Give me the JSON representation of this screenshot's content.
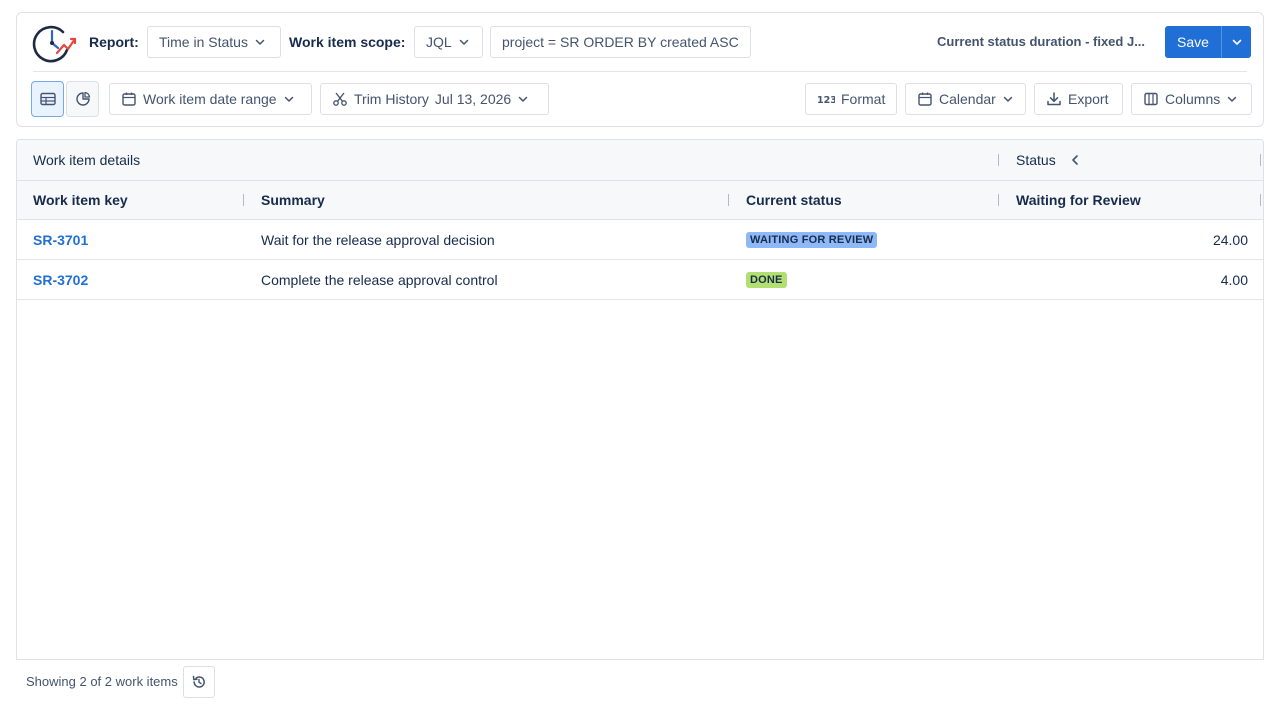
{
  "toolbar": {
    "report_label": "Report:",
    "report_value": "Time in Status",
    "scope_label": "Work item scope:",
    "scope_type": "JQL",
    "jql_query": "project = SR ORDER BY created ASC",
    "report_name": "Current status duration - fixed J...",
    "save_label": "Save",
    "date_range_label": "Work item date range",
    "trim_history_label": "Trim History",
    "trim_history_date": "Jul 13, 2026",
    "format_label": "Format",
    "calendar_label": "Calendar",
    "export_label": "Export",
    "columns_label": "Columns",
    "accent_color": "#1f6fd6"
  },
  "table": {
    "group_headers": {
      "details": "Work item details",
      "status": "Status"
    },
    "columns": {
      "key": "Work item key",
      "summary": "Summary",
      "current_status": "Current status",
      "waiting_for_review": "Waiting for Review"
    },
    "rows": [
      {
        "key": "SR-3701",
        "summary": "Wait for the release approval decision",
        "status": "WAITING FOR REVIEW",
        "status_bg": "#8fb8f6",
        "status_fg": "#172b4d",
        "waiting_for_review": "24.00"
      },
      {
        "key": "SR-3702",
        "summary": "Complete the release approval control",
        "status": "DONE",
        "status_bg": "#b3df72",
        "status_fg": "#172b4d",
        "waiting_for_review": "4.00"
      }
    ]
  },
  "footer": {
    "showing_text": "Showing 2 of 2 work items"
  }
}
